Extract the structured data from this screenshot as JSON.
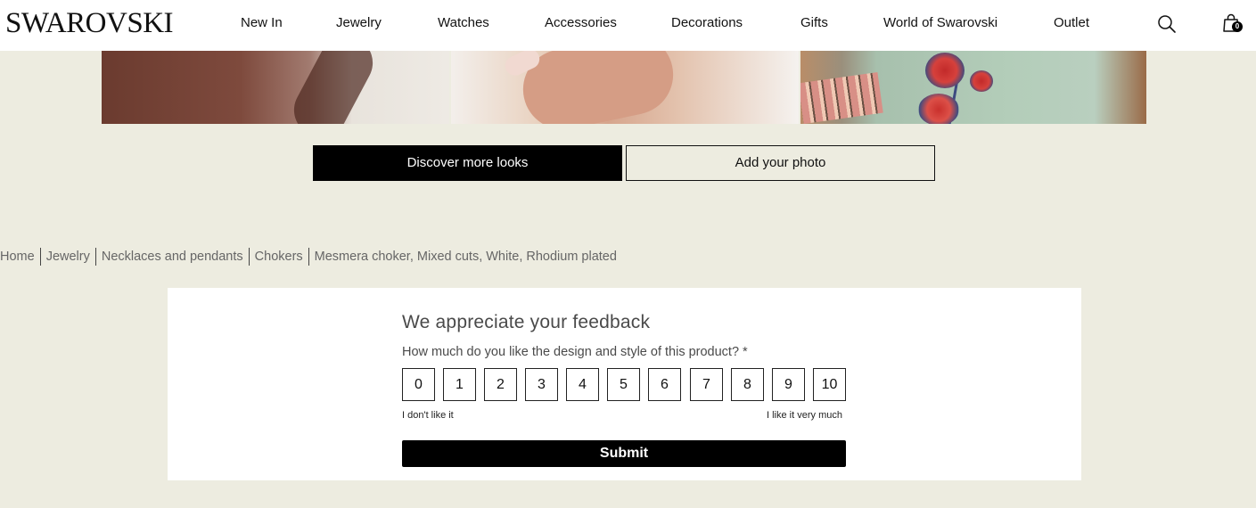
{
  "header": {
    "logo": "SWAROVSKI",
    "nav": [
      "New In",
      "Jewelry",
      "Watches",
      "Accessories",
      "Decorations",
      "Gifts",
      "World of Swarovski",
      "Outlet"
    ],
    "cart_count": "0"
  },
  "gallery": {
    "discover_label": "Discover more looks",
    "add_photo_label": "Add your photo"
  },
  "breadcrumb": [
    "Home",
    "Jewelry",
    "Necklaces and pendants",
    "Chokers",
    "Mesmera choker, Mixed cuts, White, Rhodium plated"
  ],
  "feedback": {
    "title": "We appreciate your feedback",
    "question": "How much do you like the design and style of this product? *",
    "scale": [
      "0",
      "1",
      "2",
      "3",
      "4",
      "5",
      "6",
      "7",
      "8",
      "9",
      "10"
    ],
    "low_label": "I don't like it",
    "high_label": "I like it very much",
    "submit_label": "Submit"
  },
  "colors": {
    "page_bg": "#edece0",
    "primary": "#000000",
    "text_muted": "#666666"
  }
}
